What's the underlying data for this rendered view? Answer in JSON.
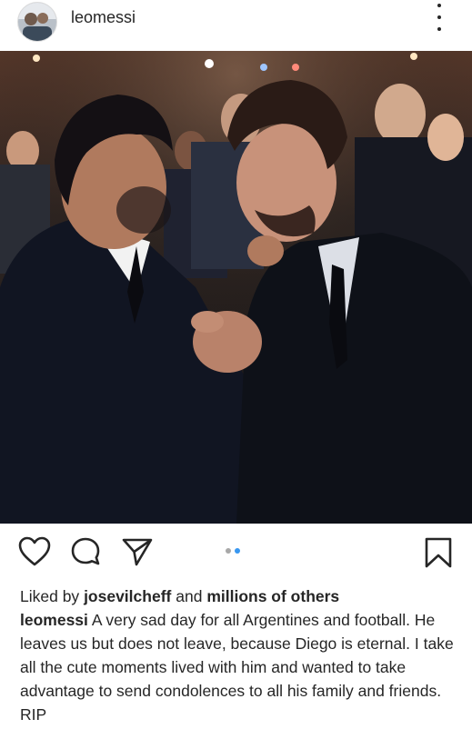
{
  "header": {
    "username": "leomessi",
    "avatar_icon": "profile-avatar",
    "more_icon": "more-vertical-icon"
  },
  "post": {
    "image_alt": "Photo of two men in suits greeting each other",
    "carousel": {
      "current": 2,
      "total": 2
    }
  },
  "actions": {
    "like_icon": "heart-icon",
    "comment_icon": "comment-icon",
    "share_icon": "send-icon",
    "save_icon": "bookmark-icon"
  },
  "likes": {
    "prefix": "Liked by",
    "user": "josevilcheff",
    "connector": "and",
    "others": "millions of others"
  },
  "caption": {
    "username": "leomessi",
    "text": "A very sad day for all Argentines and football. He leaves us but does not leave, because Diego is eternal. I take all the cute moments lived with him and wanted to take advantage to send condolences to all his family and friends. RIP"
  },
  "colors": {
    "text": "#262626",
    "active_dot": "#3897f0",
    "inactive_dot": "#a8a8a8"
  }
}
